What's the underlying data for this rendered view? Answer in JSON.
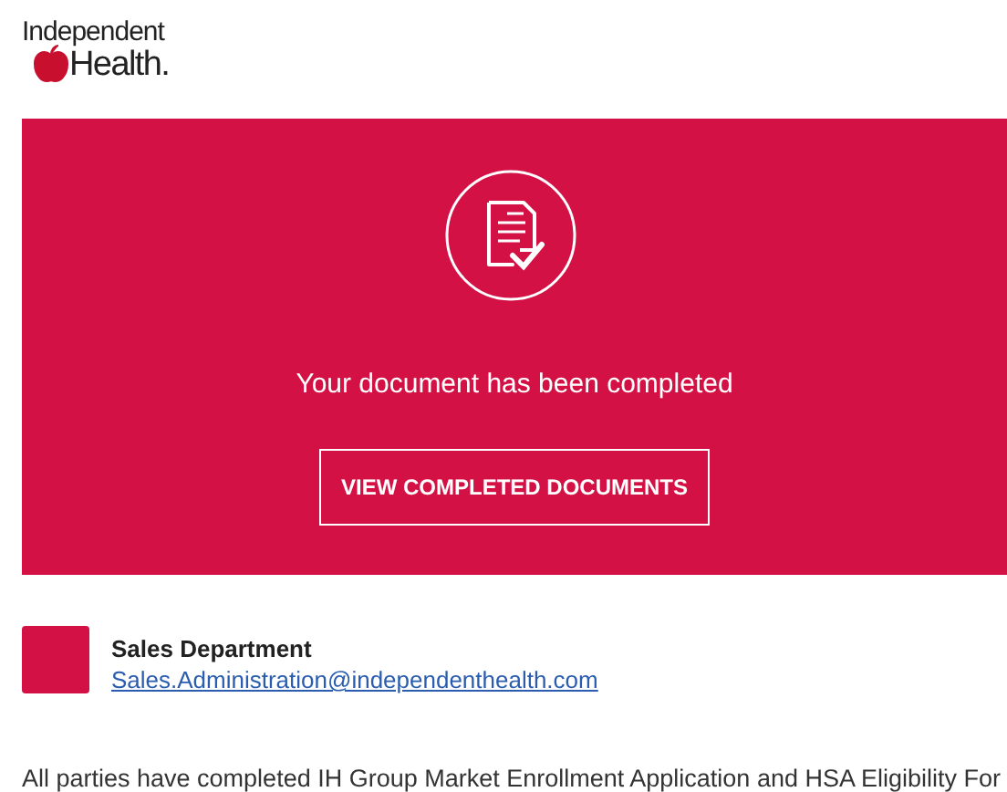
{
  "logo": {
    "line_1": "Independent",
    "line_2": "Health."
  },
  "banner": {
    "message": "Your document has been completed",
    "button": "VIEW COMPLETED DOCUMENTS"
  },
  "sender": {
    "name": "Sales Department",
    "email": "Sales.Administration@independenthealth.com"
  },
  "body": "All parties have completed IH Group Market Enrollment Application and HSA Eligibility For"
}
